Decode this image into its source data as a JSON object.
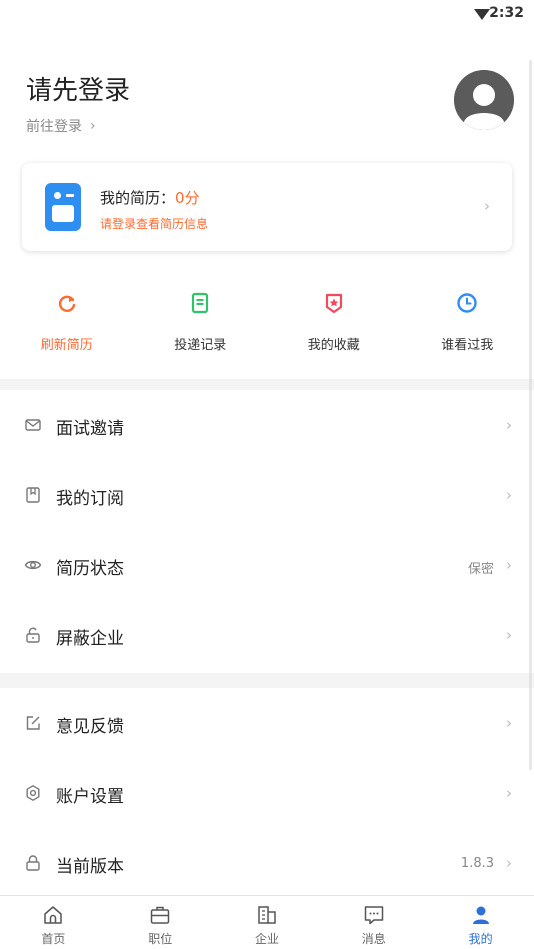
{
  "status_bar": {
    "time": "2:32"
  },
  "header": {
    "title": "请先登录",
    "login_link": "前往登录"
  },
  "resume_card": {
    "label": "我的简历：",
    "score": "0分",
    "subtitle": "请登录查看简历信息"
  },
  "quick_actions": [
    {
      "label": "刷新简历",
      "icon": "refresh-icon",
      "color": "#ff6a2f"
    },
    {
      "label": "投递记录",
      "icon": "document-list-icon",
      "color": "#2fc36b"
    },
    {
      "label": "我的收藏",
      "icon": "star-badge-icon",
      "color": "#f04a5c"
    },
    {
      "label": "谁看过我",
      "icon": "clock-icon",
      "color": "#2f8ff0"
    }
  ],
  "menu_group_1": [
    {
      "label": "面试邀请",
      "icon": "mail-icon",
      "value": ""
    },
    {
      "label": "我的订阅",
      "icon": "bookmark-icon",
      "value": ""
    },
    {
      "label": "简历状态",
      "icon": "eye-icon",
      "value": "保密"
    },
    {
      "label": "屏蔽企业",
      "icon": "unlock-icon",
      "value": ""
    }
  ],
  "menu_group_2": [
    {
      "label": "意见反馈",
      "icon": "edit-icon",
      "value": ""
    },
    {
      "label": "账户设置",
      "icon": "gear-icon",
      "value": ""
    },
    {
      "label": "当前版本",
      "icon": "lock-icon",
      "value": "1.8.3"
    }
  ],
  "tab_bar": [
    {
      "label": "首页",
      "icon": "home-icon"
    },
    {
      "label": "职位",
      "icon": "briefcase-icon"
    },
    {
      "label": "企业",
      "icon": "building-icon"
    },
    {
      "label": "消息",
      "icon": "message-icon"
    },
    {
      "label": "我的",
      "icon": "user-icon"
    }
  ],
  "colors": {
    "accent_orange": "#ff6a2f",
    "accent_blue": "#2f6fd8",
    "resume_blue": "#2f8ff0"
  }
}
